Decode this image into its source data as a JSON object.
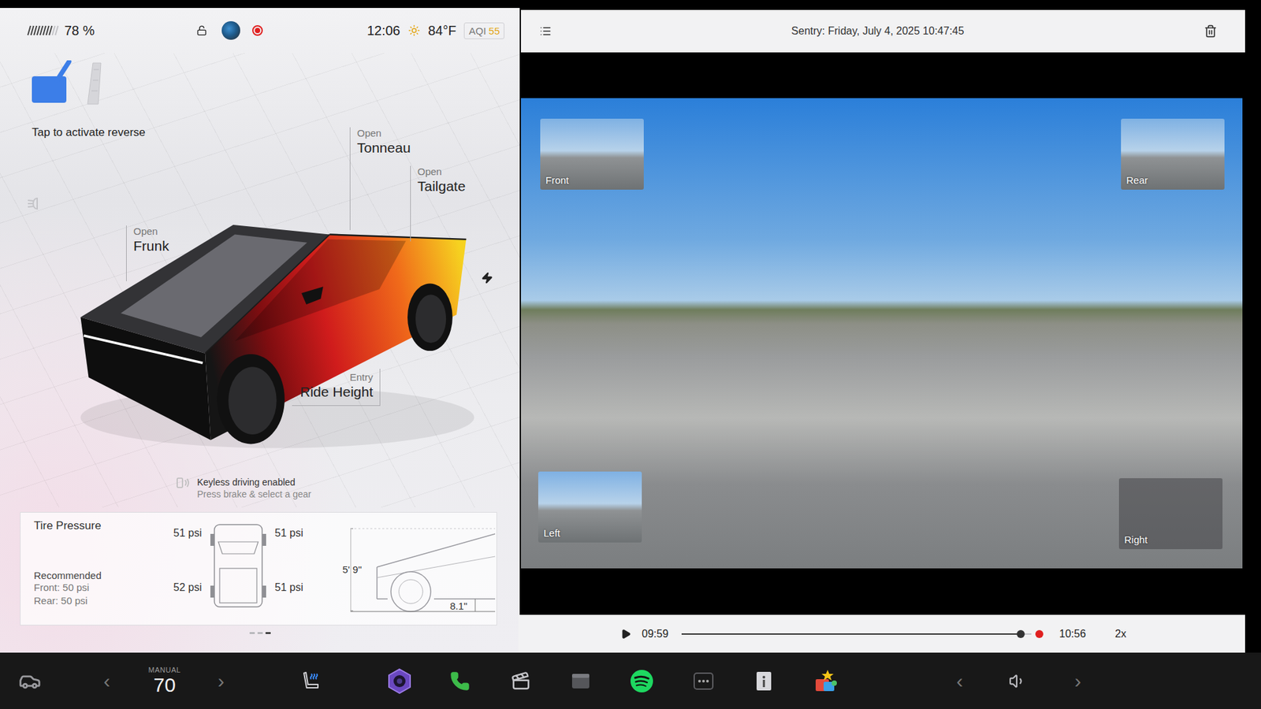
{
  "status_bar": {
    "battery": "78 %",
    "battery_level": 0.78,
    "locked": false,
    "recording": true,
    "time": "12:06",
    "temperature": "84°F",
    "aqi_label": "AQI",
    "aqi_value": "55"
  },
  "gear": {
    "hint": "Tap to activate reverse"
  },
  "callouts": [
    {
      "state": "Open",
      "label": "Tonneau",
      "kind": "vertical"
    },
    {
      "state": "Open",
      "label": "Tailgate",
      "kind": "vertical"
    },
    {
      "state": "Open",
      "label": "Frunk",
      "kind": "vertical"
    },
    {
      "state": "Entry",
      "label": "Ride Height",
      "kind": "corner"
    }
  ],
  "keyless": {
    "title": "Keyless driving enabled",
    "subtitle": "Press brake & select a gear"
  },
  "tire_pressure": {
    "title": "Tire Pressure",
    "recommended": "Recommended",
    "front": "Front: 50 psi",
    "rear": "Rear: 50 psi",
    "tires": [
      {
        "position": "front-left",
        "reading": "51 psi"
      },
      {
        "position": "front-right",
        "reading": "51 psi"
      },
      {
        "position": "rear-left",
        "reading": "52 psi"
      },
      {
        "position": "rear-right",
        "reading": "51 psi"
      }
    ],
    "height": "5' 9\"",
    "clearance": "8.1\""
  },
  "pager": [
    {
      "selected": false
    },
    {
      "selected": false
    },
    {
      "selected": true
    }
  ],
  "sentry": {
    "title": "Sentry: Friday, July 4, 2025 10:47:45",
    "cameras": [
      {
        "label": "Front",
        "active": true
      },
      {
        "label": "Rear",
        "active": true
      },
      {
        "label": "Left",
        "active": true
      },
      {
        "label": "Right",
        "active": false
      }
    ],
    "playback": {
      "start": "09:59",
      "end": "10:56",
      "level": 0.97,
      "speed": "2x"
    }
  },
  "dock": {
    "climate_mode": "MANUAL",
    "temperature": "70",
    "prev": "‹",
    "next": "›",
    "volume_prev": "‹",
    "volume_next": "›"
  }
}
